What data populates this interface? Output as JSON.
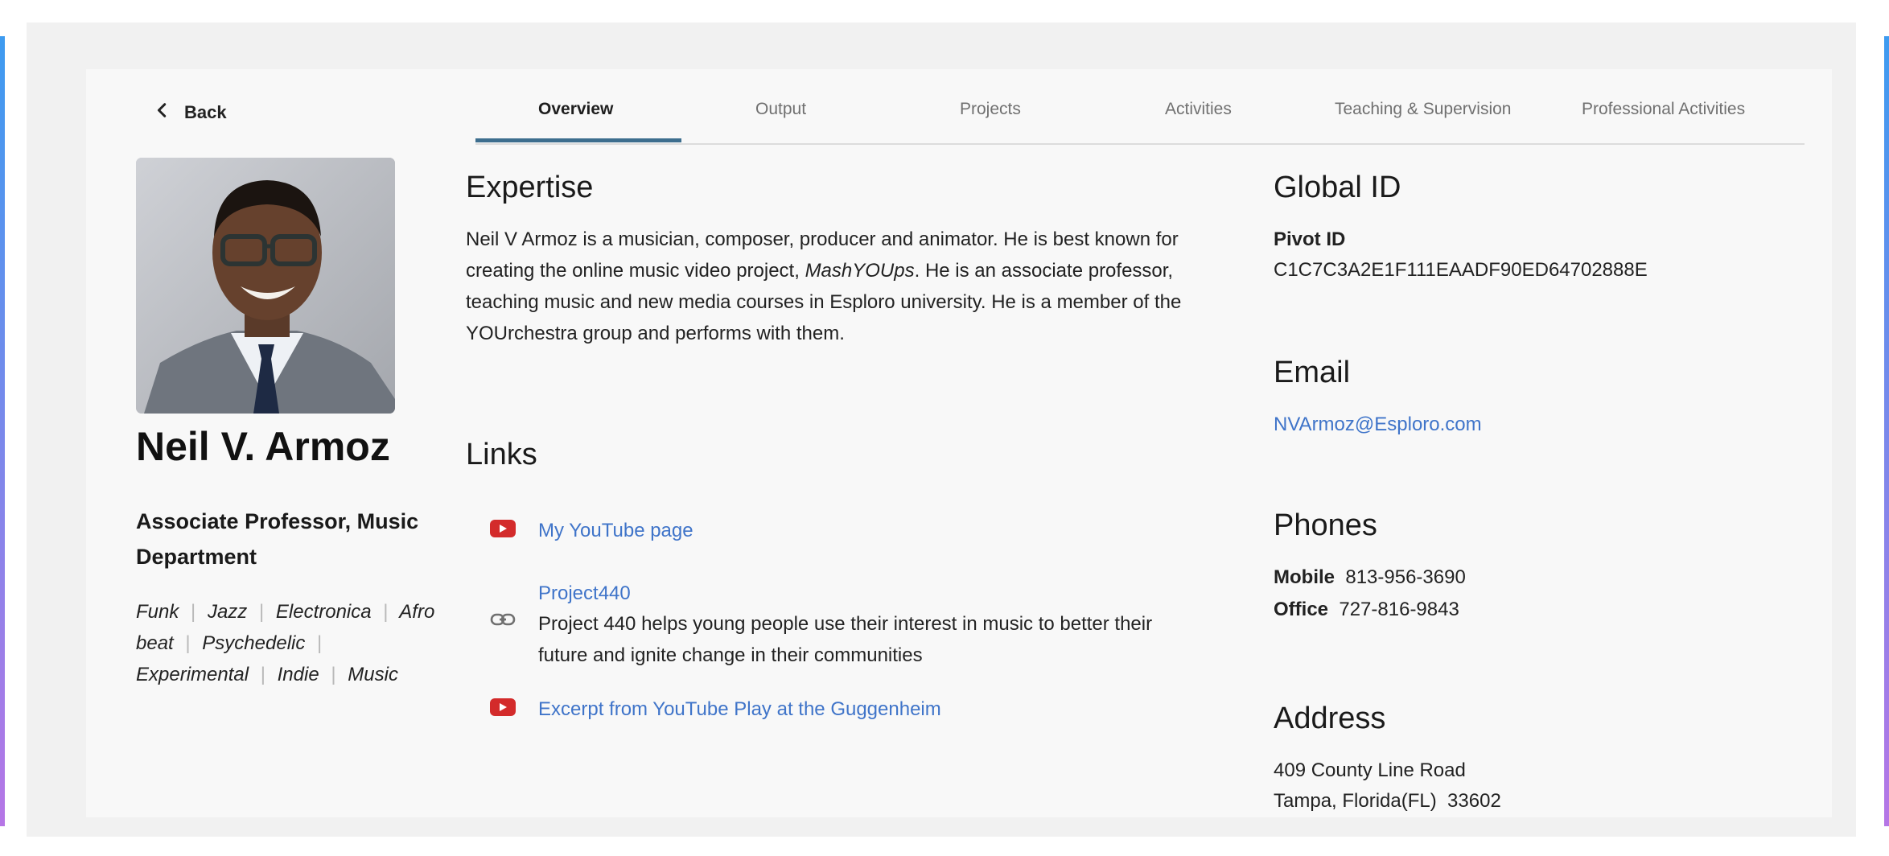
{
  "nav": {
    "back_label": "Back"
  },
  "profile": {
    "name": "Neil V. Armoz",
    "role": "Associate Professor, Music Department",
    "tags": [
      "Funk",
      "Jazz",
      "Electronica",
      "Afro beat",
      "Psychedelic",
      "Experimental",
      "Indie",
      "Music"
    ]
  },
  "tabs": [
    {
      "label": "Overview",
      "active": true
    },
    {
      "label": "Output"
    },
    {
      "label": "Projects"
    },
    {
      "label": "Activities"
    },
    {
      "label": "Teaching & Supervision"
    },
    {
      "label": "Professional Activities"
    }
  ],
  "expertise": {
    "heading": "Expertise",
    "text_before": "Neil V Armoz is a musician, composer, producer and animator. He is best known for creating the online music video project, ",
    "text_italic": "MashYOUps",
    "text_after": ". He is an associate professor, teaching music and new media courses in Esploro university. He is a member of the YOUrchestra group and performs with them."
  },
  "links": {
    "heading": "Links",
    "items": [
      {
        "icon": "youtube-icon",
        "title": "My YouTube page"
      },
      {
        "icon": "link-chain-icon",
        "title": "Project440",
        "description": "Project 440 helps young people use their interest in music to better their future and ignite change in their communities"
      },
      {
        "icon": "youtube-icon",
        "title": "Excerpt from YouTube Play at the Guggenheim"
      }
    ]
  },
  "global_id": {
    "heading": "Global ID",
    "label": "Pivot ID",
    "value": "C1C7C3A2E1F111EAADF90ED64702888E"
  },
  "email": {
    "heading": "Email",
    "value": "NVArmoz@Esploro.com"
  },
  "phones": {
    "heading": "Phones",
    "mobile_label": "Mobile",
    "mobile_value": "813-956-3690",
    "office_label": "Office",
    "office_value": "727-816-9843"
  },
  "address": {
    "heading": "Address",
    "line1": "409 County Line Road",
    "line2": "Tampa, Florida(FL)  33602"
  },
  "colors": {
    "link": "#3f74c9",
    "tab_underline": "#3d6e8e",
    "youtube": "#d32b2b"
  }
}
